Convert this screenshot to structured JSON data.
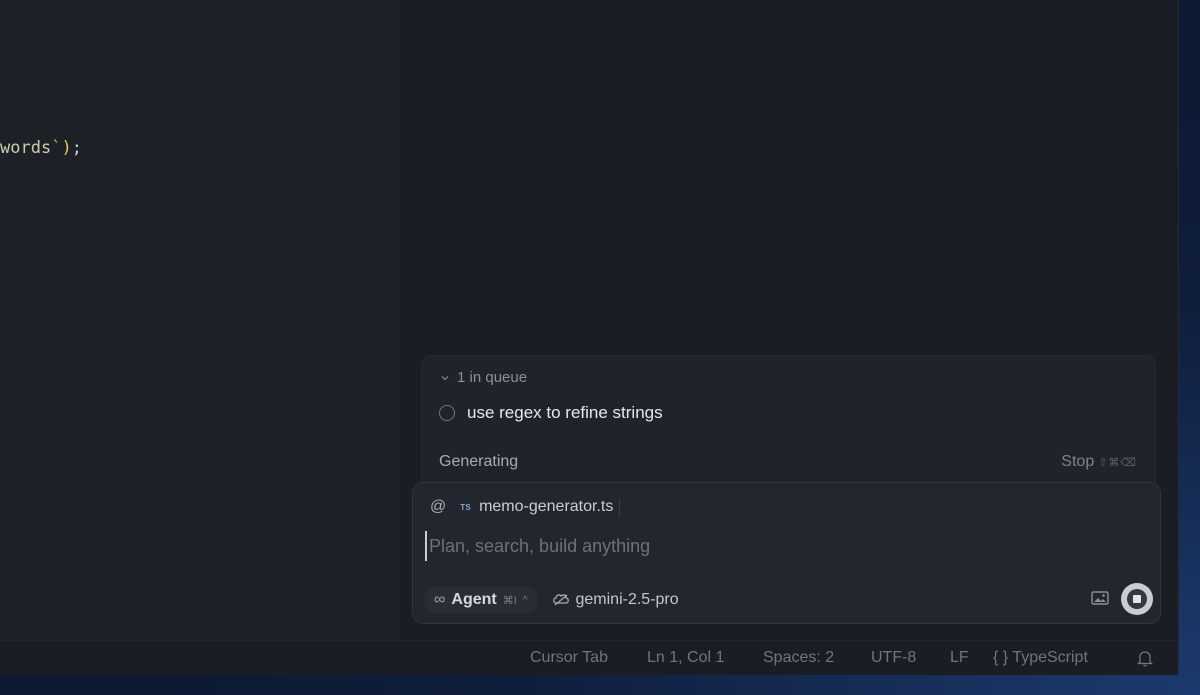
{
  "editor": {
    "code_fragment": {
      "string_text": "words",
      "tick": "`",
      "paren": ")",
      "semicolon": ";"
    }
  },
  "queue": {
    "header": "1 in queue",
    "item": "use regex to refine strings",
    "status": "Generating",
    "stop_label": "Stop",
    "stop_shortcut": "⇧⌘⌫"
  },
  "composer": {
    "context_at": "@",
    "file_type_badge": "TS",
    "file_name": "memo-generator.ts",
    "placeholder": "Plan, search, build anything",
    "value": "",
    "mode_label": "Agent",
    "mode_shortcut": "⌘I",
    "mode_caret": "^",
    "infinity_glyph": "∞",
    "model_name": "gemini-2.5-pro"
  },
  "statusbar": {
    "cursor_tab": "Cursor Tab",
    "position": "Ln 1, Col 1",
    "spaces": "Spaces: 2",
    "encoding": "UTF-8",
    "eol": "LF",
    "language_braces": "{ }",
    "language": "TypeScript"
  },
  "colors": {
    "background": "#1b1d24",
    "panel": "#20232b",
    "composer": "#23262e",
    "code_string": "#c9cfa9",
    "code_paren": "#e7c84f"
  }
}
